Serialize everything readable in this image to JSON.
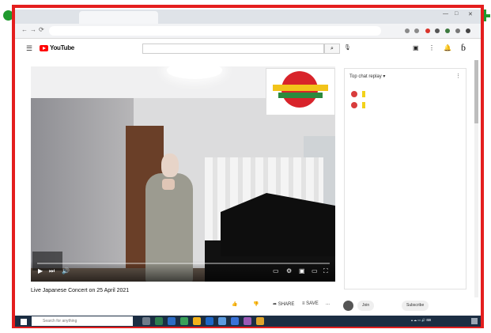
{
  "browser": {
    "tab_title": "",
    "url": "",
    "window_controls": [
      "—",
      "□",
      "✕"
    ],
    "nav": [
      "←",
      "→",
      "⟳"
    ]
  },
  "youtube": {
    "logo_text": "YouTube",
    "search_value": "",
    "search_icon": "search-icon",
    "mic_icon": "mic-icon"
  },
  "video": {
    "title": "Live Japanese Concert on 25 April 2021",
    "meta": "",
    "time": "",
    "progress": 0,
    "badge_text": ""
  },
  "actions": {
    "likes": "",
    "dislikes": "",
    "share": "SHARE",
    "save": "SAVE",
    "more": "...",
    "join": "Join",
    "subscribe": "Subscribe"
  },
  "chat": {
    "header": "Top chat replay ▾",
    "messages": [
      {
        "name": "",
        "text": ""
      },
      {
        "name": "",
        "text": ""
      }
    ],
    "footer": ""
  },
  "taskbar": {
    "search_placeholder": "Search for anything",
    "time": "",
    "date": ""
  },
  "colors": {
    "frame": "#e41e1e",
    "annotation": "#1f9a2e",
    "youtube_red": "#ff0000",
    "chat_highlight": "#f2d21a"
  }
}
